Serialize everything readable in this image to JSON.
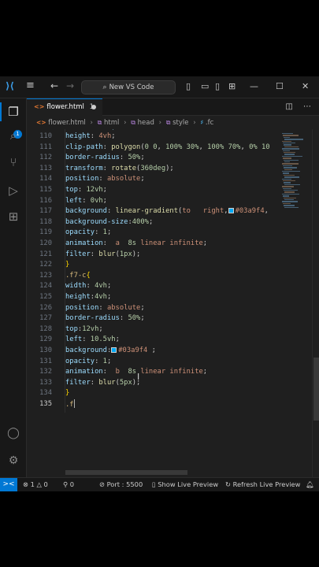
{
  "window": {
    "search_label": "New VS Code",
    "nav_back": "←",
    "nav_forward": "→",
    "menu_icon": "≡"
  },
  "tab": {
    "label": "flower.html",
    "problems": "1"
  },
  "breadcrumb": [
    "flower.html",
    "html",
    "head",
    "style",
    ".fc"
  ],
  "activity": {
    "explorer_badge": "1"
  },
  "editor": {
    "lines": [
      {
        "n": "110",
        "segs": [
          [
            "p",
            "height"
          ],
          [
            "w",
            ": "
          ],
          [
            "v",
            "4vh"
          ],
          [
            "w",
            ";"
          ]
        ]
      },
      {
        "n": "111",
        "segs": [
          [
            "p",
            "clip-path"
          ],
          [
            "w",
            ": "
          ],
          [
            "f",
            "polygon"
          ],
          [
            "w",
            "("
          ],
          [
            "n",
            "0 0"
          ],
          [
            "w",
            ", "
          ],
          [
            "n",
            "100% 30%"
          ],
          [
            "w",
            ", "
          ],
          [
            "n",
            "100% 70%"
          ],
          [
            "w",
            ", "
          ],
          [
            "n",
            "0% 10"
          ]
        ]
      },
      {
        "n": "112",
        "segs": [
          [
            "p",
            "border-radius"
          ],
          [
            "w",
            ": "
          ],
          [
            "n",
            "50%"
          ],
          [
            "w",
            ";"
          ]
        ]
      },
      {
        "n": "113",
        "segs": [
          [
            "p",
            "transform"
          ],
          [
            "w",
            ": "
          ],
          [
            "f",
            "rotate"
          ],
          [
            "w",
            "("
          ],
          [
            "n",
            "360deg"
          ],
          [
            "w",
            ");"
          ]
        ]
      },
      {
        "n": "114",
        "segs": [
          [
            "p",
            "position"
          ],
          [
            "w",
            ": "
          ],
          [
            "v",
            "absolute"
          ],
          [
            "w",
            ";"
          ]
        ]
      },
      {
        "n": "115",
        "segs": [
          [
            "p",
            "top"
          ],
          [
            "w",
            ": "
          ],
          [
            "n",
            "12vh"
          ],
          [
            "w",
            ";"
          ]
        ]
      },
      {
        "n": "116",
        "segs": [
          [
            "p",
            "left"
          ],
          [
            "w",
            ": "
          ],
          [
            "n",
            "0vh"
          ],
          [
            "w",
            ";"
          ]
        ]
      },
      {
        "n": "117",
        "segs": [
          [
            "p",
            "background"
          ],
          [
            "w",
            ": "
          ],
          [
            "f",
            "linear-gradient"
          ],
          [
            "w",
            "("
          ],
          [
            "v",
            "to   right"
          ],
          [
            "w",
            ","
          ],
          [
            "sw",
            ""
          ],
          [
            "v",
            "#03a9f4"
          ],
          [
            "w",
            ","
          ]
        ]
      },
      {
        "n": "118",
        "segs": [
          [
            "p",
            "background-size"
          ],
          [
            "w",
            ":"
          ],
          [
            "n",
            "400%"
          ],
          [
            "w",
            ";"
          ]
        ]
      },
      {
        "n": "119",
        "segs": [
          [
            "p",
            "opacity"
          ],
          [
            "w",
            ": "
          ],
          [
            "n",
            "1"
          ],
          [
            "w",
            ";"
          ]
        ]
      },
      {
        "n": "120",
        "segs": [
          [
            "p",
            "animation"
          ],
          [
            "w",
            ":  "
          ],
          [
            "v",
            "a  "
          ],
          [
            "n",
            "8s"
          ],
          [
            "v",
            " linear infinite"
          ],
          [
            "w",
            ";"
          ]
        ]
      },
      {
        "n": "121",
        "segs": [
          [
            "p",
            "filter"
          ],
          [
            "w",
            ": "
          ],
          [
            "f",
            "blur"
          ],
          [
            "w",
            "("
          ],
          [
            "n",
            "1px"
          ],
          [
            "w",
            ");"
          ]
        ]
      },
      {
        "n": "122",
        "segs": [
          [
            "b",
            "}"
          ]
        ]
      },
      {
        "n": "123",
        "segs": [
          [
            "s",
            ".f7-c"
          ],
          [
            "b",
            "{"
          ]
        ]
      },
      {
        "n": "124",
        "segs": [
          [
            "p",
            "width"
          ],
          [
            "w",
            ": "
          ],
          [
            "n",
            "4vh"
          ],
          [
            "w",
            ";"
          ]
        ]
      },
      {
        "n": "125",
        "segs": [
          [
            "p",
            "height"
          ],
          [
            "w",
            ":"
          ],
          [
            "n",
            "4vh"
          ],
          [
            "w",
            ";"
          ]
        ]
      },
      {
        "n": "126",
        "segs": [
          [
            "p",
            "position"
          ],
          [
            "w",
            ": "
          ],
          [
            "v",
            "absolute"
          ],
          [
            "w",
            ";"
          ]
        ]
      },
      {
        "n": "127",
        "segs": [
          [
            "p",
            "border-radius"
          ],
          [
            "w",
            ": "
          ],
          [
            "n",
            "50%"
          ],
          [
            "w",
            ";"
          ]
        ]
      },
      {
        "n": "128",
        "segs": [
          [
            "p",
            "top"
          ],
          [
            "w",
            ":"
          ],
          [
            "n",
            "12vh"
          ],
          [
            "w",
            ";"
          ]
        ]
      },
      {
        "n": "129",
        "segs": [
          [
            "p",
            "left"
          ],
          [
            "w",
            ": "
          ],
          [
            "n",
            "10.5vh"
          ],
          [
            "w",
            ";"
          ]
        ]
      },
      {
        "n": "130",
        "segs": [
          [
            "p",
            "background"
          ],
          [
            "w",
            ":"
          ],
          [
            "sw",
            ""
          ],
          [
            "v",
            "#03a9f4"
          ],
          [
            "w",
            " ;"
          ]
        ]
      },
      {
        "n": "131",
        "segs": [
          [
            "p",
            "opacity"
          ],
          [
            "w",
            ": "
          ],
          [
            "n",
            "1"
          ],
          [
            "w",
            ";"
          ]
        ]
      },
      {
        "n": "132",
        "segs": [
          [
            "p",
            "animation"
          ],
          [
            "w",
            ":  "
          ],
          [
            "v",
            "b  "
          ],
          [
            "n",
            "8s"
          ],
          [
            "v",
            " linear infinite"
          ],
          [
            "w",
            ";"
          ]
        ]
      },
      {
        "n": "133",
        "segs": [
          [
            "p",
            "filter"
          ],
          [
            "w",
            ": "
          ],
          [
            "f",
            "blur"
          ],
          [
            "w",
            "("
          ],
          [
            "n",
            "5px"
          ],
          [
            "w",
            ");"
          ]
        ]
      },
      {
        "n": "134",
        "segs": [
          [
            "b",
            "}"
          ]
        ]
      },
      {
        "n": "135",
        "segs": [
          [
            "s",
            ".f"
          ],
          [
            "caret",
            ""
          ]
        ]
      }
    ],
    "accent_color": "#03a9f4"
  },
  "statusbar": {
    "remote_icon": "><",
    "errors": "1",
    "warnings": "0",
    "ports": "0",
    "port_label": "Port : 5500",
    "live_preview": "Show Live Preview",
    "refresh_preview": "Refresh Live Preview"
  },
  "colors": {
    "accent": "#0078d4",
    "editor_bg": "#1f1f1f",
    "chrome_bg": "#181818",
    "property": "#9cdcfe",
    "value": "#ce9178",
    "number": "#b5cea8",
    "function": "#dcdcaa"
  }
}
